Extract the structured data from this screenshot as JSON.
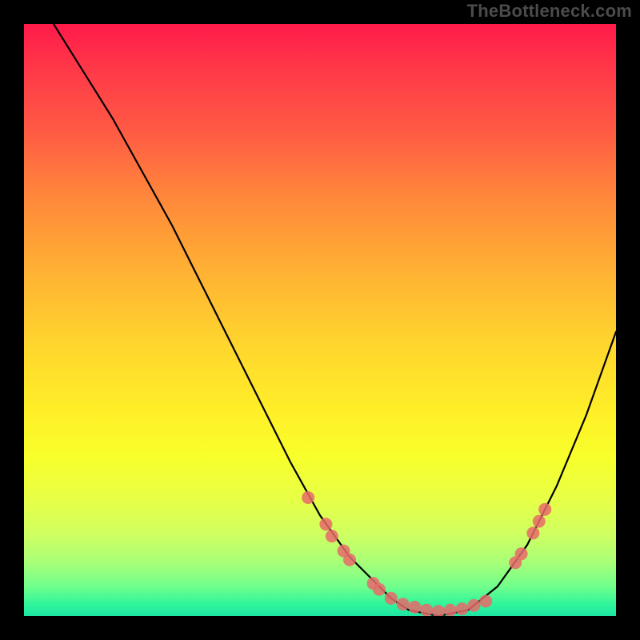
{
  "attribution": "TheBottleneck.com",
  "chart_data": {
    "type": "line",
    "title": "",
    "xlabel": "",
    "ylabel": "",
    "xlim": [
      0,
      100
    ],
    "ylim": [
      0,
      100
    ],
    "curve": {
      "x": [
        5,
        10,
        15,
        20,
        25,
        30,
        35,
        40,
        45,
        50,
        55,
        60,
        62,
        65,
        70,
        75,
        80,
        85,
        90,
        95,
        100
      ],
      "y": [
        100,
        92,
        84,
        75,
        66,
        56,
        46,
        36,
        26,
        17,
        10,
        5,
        3,
        1,
        0,
        1,
        5,
        12,
        22,
        34,
        48
      ]
    },
    "scatter_points": [
      {
        "x": 48,
        "y": 20
      },
      {
        "x": 51,
        "y": 15.5
      },
      {
        "x": 52,
        "y": 13.5
      },
      {
        "x": 54,
        "y": 11
      },
      {
        "x": 55,
        "y": 9.5
      },
      {
        "x": 59,
        "y": 5.5
      },
      {
        "x": 60,
        "y": 4.5
      },
      {
        "x": 62,
        "y": 3
      },
      {
        "x": 64,
        "y": 2
      },
      {
        "x": 66,
        "y": 1.5
      },
      {
        "x": 68,
        "y": 1
      },
      {
        "x": 70,
        "y": 0.8
      },
      {
        "x": 72,
        "y": 1
      },
      {
        "x": 74,
        "y": 1.2
      },
      {
        "x": 76,
        "y": 1.8
      },
      {
        "x": 78,
        "y": 2.5
      },
      {
        "x": 83,
        "y": 9
      },
      {
        "x": 84,
        "y": 10.5
      },
      {
        "x": 86,
        "y": 14
      },
      {
        "x": 87,
        "y": 16
      },
      {
        "x": 88,
        "y": 18
      }
    ],
    "colors": {
      "curve": "#000000",
      "points": "#e86a6a",
      "gradient_top": "#ff1a4a",
      "gradient_bottom": "#1ee6a3"
    }
  }
}
